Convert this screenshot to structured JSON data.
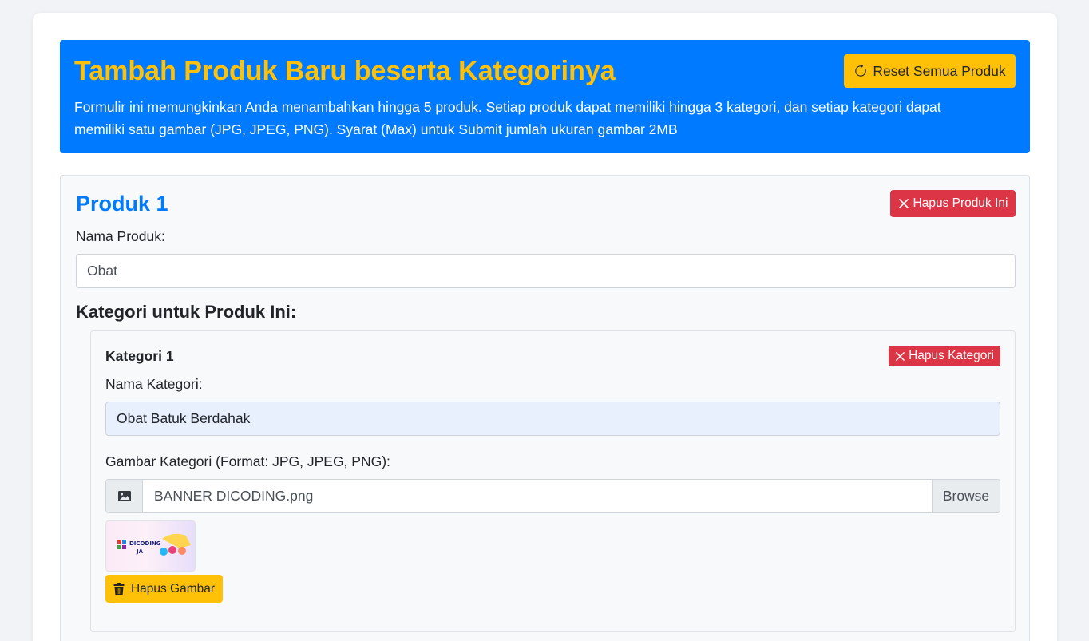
{
  "banner": {
    "title": "Tambah Produk Baru beserta Kategorinya",
    "description": "Formulir ini memungkinkan Anda menambahkan hingga 5 produk. Setiap produk dapat memiliki hingga 3 kategori, dan setiap kategori dapat memiliki satu gambar (JPG, JPEG, PNG). Syarat (Max) untuk Submit jumlah ukuran gambar 2MB",
    "reset_button": "Reset Semua Produk"
  },
  "product": {
    "title": "Produk 1",
    "delete_button": "Hapus Produk Ini",
    "name_label": "Nama Produk:",
    "name_value": "Obat",
    "categories_heading": "Kategori untuk Produk Ini:",
    "category": {
      "title": "Kategori 1",
      "delete_button": "Hapus Kategori",
      "name_label": "Nama Kategori:",
      "name_value": "Obat Batuk Berdahak",
      "image_label": "Gambar Kategori (Format: JPG, JPEG, PNG):",
      "file_name": "BANNER DICODING.png",
      "browse_label": "Browse",
      "thumbnail_text_top": "DICODING",
      "thumbnail_text_bottom": "JA",
      "delete_image_button": "Hapus Gambar"
    }
  },
  "colors": {
    "primary": "#007bff",
    "warning": "#ffc107",
    "danger": "#dc3545",
    "page_background": "#f1f3f7"
  },
  "icons": [
    "redo-icon",
    "close-icon",
    "image-icon",
    "trash-icon"
  ]
}
